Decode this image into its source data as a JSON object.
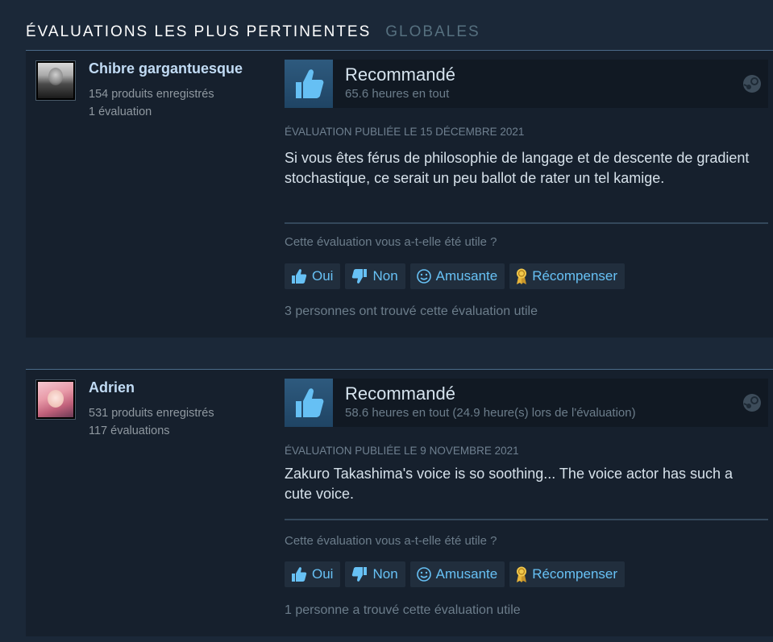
{
  "section": {
    "title": "Évaluations les plus pertinentes",
    "subtitle": "Globales"
  },
  "colors": {
    "background": "#1b2838",
    "card": "#16202d",
    "link": "#67c1f5",
    "persona": "#c1dbf4",
    "thumb_box": "#2e5a7e"
  },
  "reviews": [
    {
      "author": {
        "name": "Chibre gargantuesque",
        "products": "154 produits enregistrés",
        "reviews": "1 évaluation",
        "avatar_icon": "avatar-portrait-grayscale"
      },
      "verdict": "Recommandé",
      "hours": "65.6 heures en tout",
      "posted": "Évaluation publiée le 15 décembre 2021",
      "content": "Si vous êtes férus de philosophie de langage et de descente de gradient stochastique, ce serait un peu ballot de rater un tel kamige.",
      "helpful_question": "Cette évaluation vous a-t-elle été utile ?",
      "buttons": {
        "yes": "Oui",
        "no": "Non",
        "funny": "Amusante",
        "award": "Récompenser"
      },
      "found_helpful": "3 personnes ont trouvé cette évaluation utile"
    },
    {
      "author": {
        "name": "Adrien",
        "products": "531 produits enregistrés",
        "reviews": "117 évaluations",
        "avatar_icon": "avatar-anime-pink"
      },
      "verdict": "Recommandé",
      "hours": "58.6 heures en tout (24.9 heure(s) lors de l'évaluation)",
      "posted": "Évaluation publiée le 9 novembre 2021",
      "content": "Zakuro Takashima's voice is so soothing... The voice actor has such a cute voice.",
      "helpful_question": "Cette évaluation vous a-t-elle été utile ?",
      "buttons": {
        "yes": "Oui",
        "no": "Non",
        "funny": "Amusante",
        "award": "Récompenser"
      },
      "found_helpful": "1 personne a trouvé cette évaluation utile"
    }
  ]
}
